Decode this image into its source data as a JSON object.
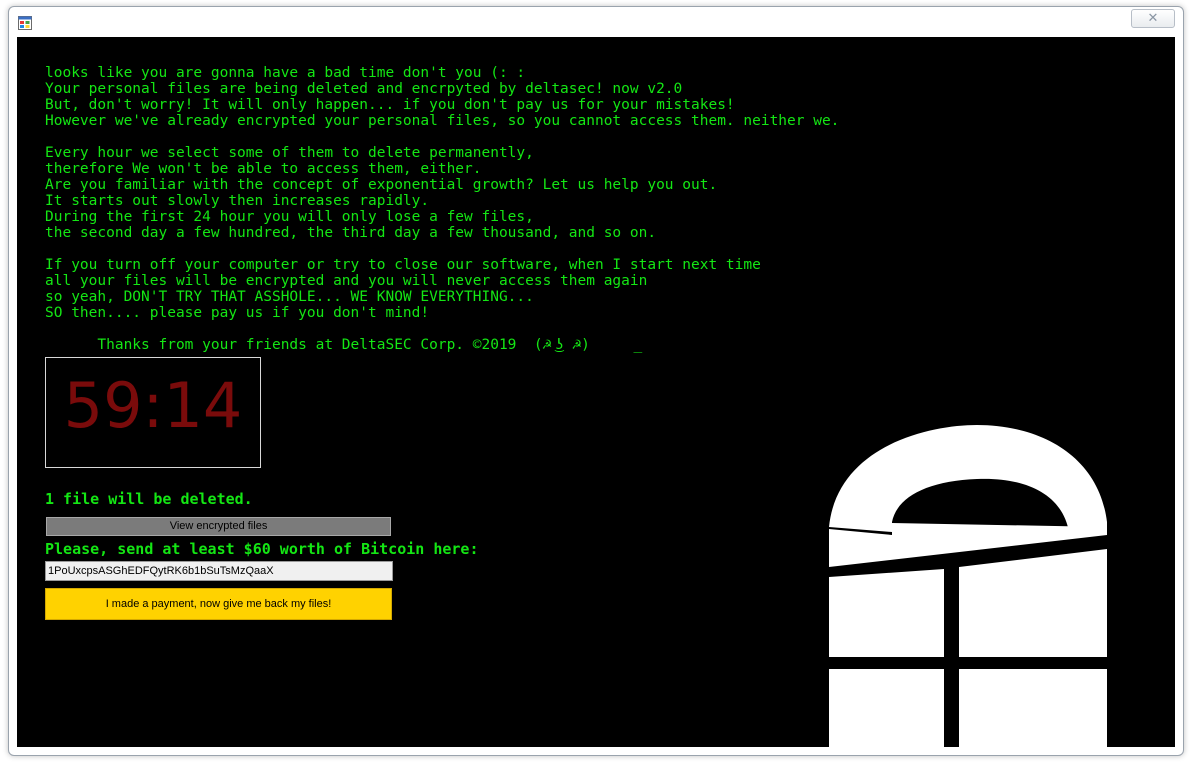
{
  "window": {
    "close_glyph": "✕"
  },
  "message": {
    "text": "looks like you are gonna have a bad time don't you (: :\nYour personal files are being deleted and encrpyted by deltasec! now v2.0\nBut, don't worry! It will only happen... if you don't pay us for your mistakes!\nHowever we've already encrypted your personal files, so you cannot access them. neither we.\n\nEvery hour we select some of them to delete permanently,\ntherefore We won't be able to access them, either.\nAre you familiar with the concept of exponential growth? Let us help you out.\nIt starts out slowly then increases rapidly.\nDuring the first 24 hour you will only lose a few files,\nthe second day a few hundred, the third day a few thousand, and so on.\n\nIf you turn off your computer or try to close our software, when I start next time\nall your files will be encrypted and you will never access them again\nso yeah, DON'T TRY THAT ASSHOLE... WE KNOW EVERYTHING...\nSO then.... please pay us if you don't mind!\n\n      Thanks from your friends at DeltaSEC Corp. ©2019  (☭ ͜ʖ ☭)     _"
  },
  "timer": {
    "value": "59:14"
  },
  "status": {
    "deleted_label": "1 file will be deleted."
  },
  "buttons": {
    "view_encrypted": "View encrypted files",
    "payment_made": "I made a payment, now give me back my files!"
  },
  "payment": {
    "send_label": "Please, send at least $60 worth of Bitcoin here:",
    "bitcoin_address": "1PoUxcpsASGhEDFQytRK6b1bSuTsMzQaaX"
  },
  "colors": {
    "background": "#000000",
    "text_green": "#14e614",
    "timer_red": "#7a0b0b",
    "pay_button": "#ffd200",
    "view_button": "#7b7b7b"
  },
  "icons": {
    "app": "window-app-icon",
    "logo": "windows-logo-icon"
  }
}
